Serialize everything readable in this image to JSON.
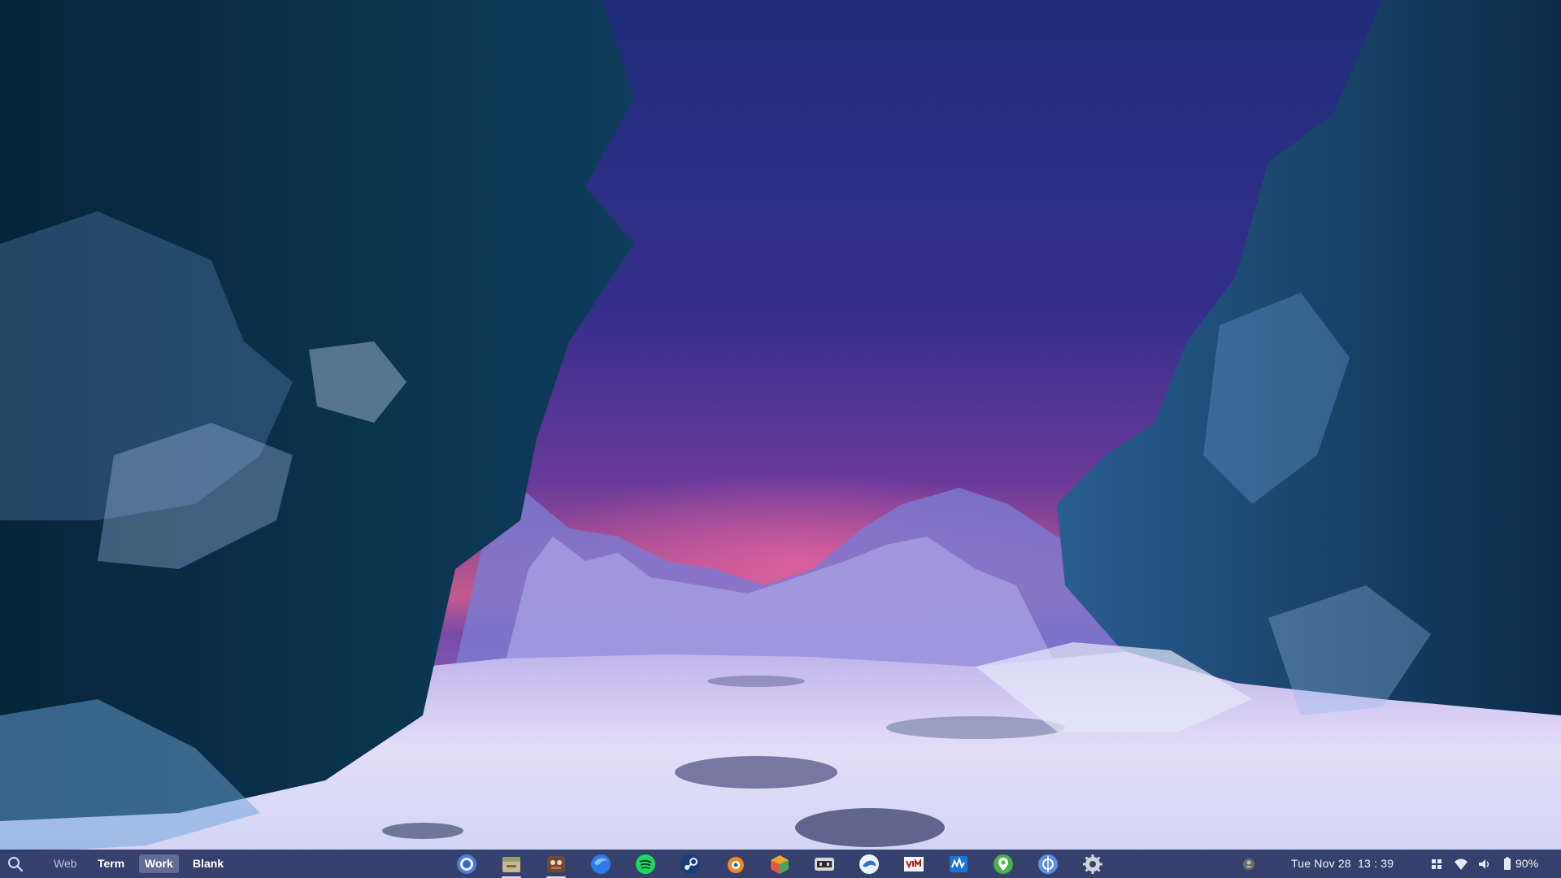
{
  "panel": {
    "search_icon": "search-icon",
    "workspaces": [
      {
        "label": "Web",
        "state": "inactive"
      },
      {
        "label": "Term",
        "state": "normal"
      },
      {
        "label": "Work",
        "state": "active"
      },
      {
        "label": "Blank",
        "state": "normal"
      }
    ],
    "dock": [
      {
        "icon": "chromium-icon",
        "running": false
      },
      {
        "icon": "files-icon",
        "running": true
      },
      {
        "icon": "game-app-icon",
        "running": true
      },
      {
        "icon": "browser-icon",
        "running": false
      },
      {
        "icon": "spotify-icon",
        "running": false
      },
      {
        "icon": "steam-icon",
        "running": false
      },
      {
        "icon": "blender-icon",
        "running": false
      },
      {
        "icon": "3d-cube-app-icon",
        "running": false
      },
      {
        "icon": "gamepad-app-icon",
        "running": false
      },
      {
        "icon": "wireshark-like-icon",
        "running": false
      },
      {
        "icon": "vim-app-icon",
        "running": false
      },
      {
        "icon": "audio-editor-icon",
        "running": false
      },
      {
        "icon": "maps-icon",
        "running": false
      },
      {
        "icon": "virtual-desktop-icon",
        "running": false
      },
      {
        "icon": "settings-icon",
        "running": false
      }
    ],
    "tray": {
      "status_icon": "user-status-icon",
      "clock": "Tue Nov 28  13 : 39",
      "tiling_icon": "tiling-icon",
      "wifi_icon": "wifi-icon",
      "volume_icon": "volume-icon",
      "battery_icon": "battery-icon",
      "battery": "90%"
    }
  }
}
